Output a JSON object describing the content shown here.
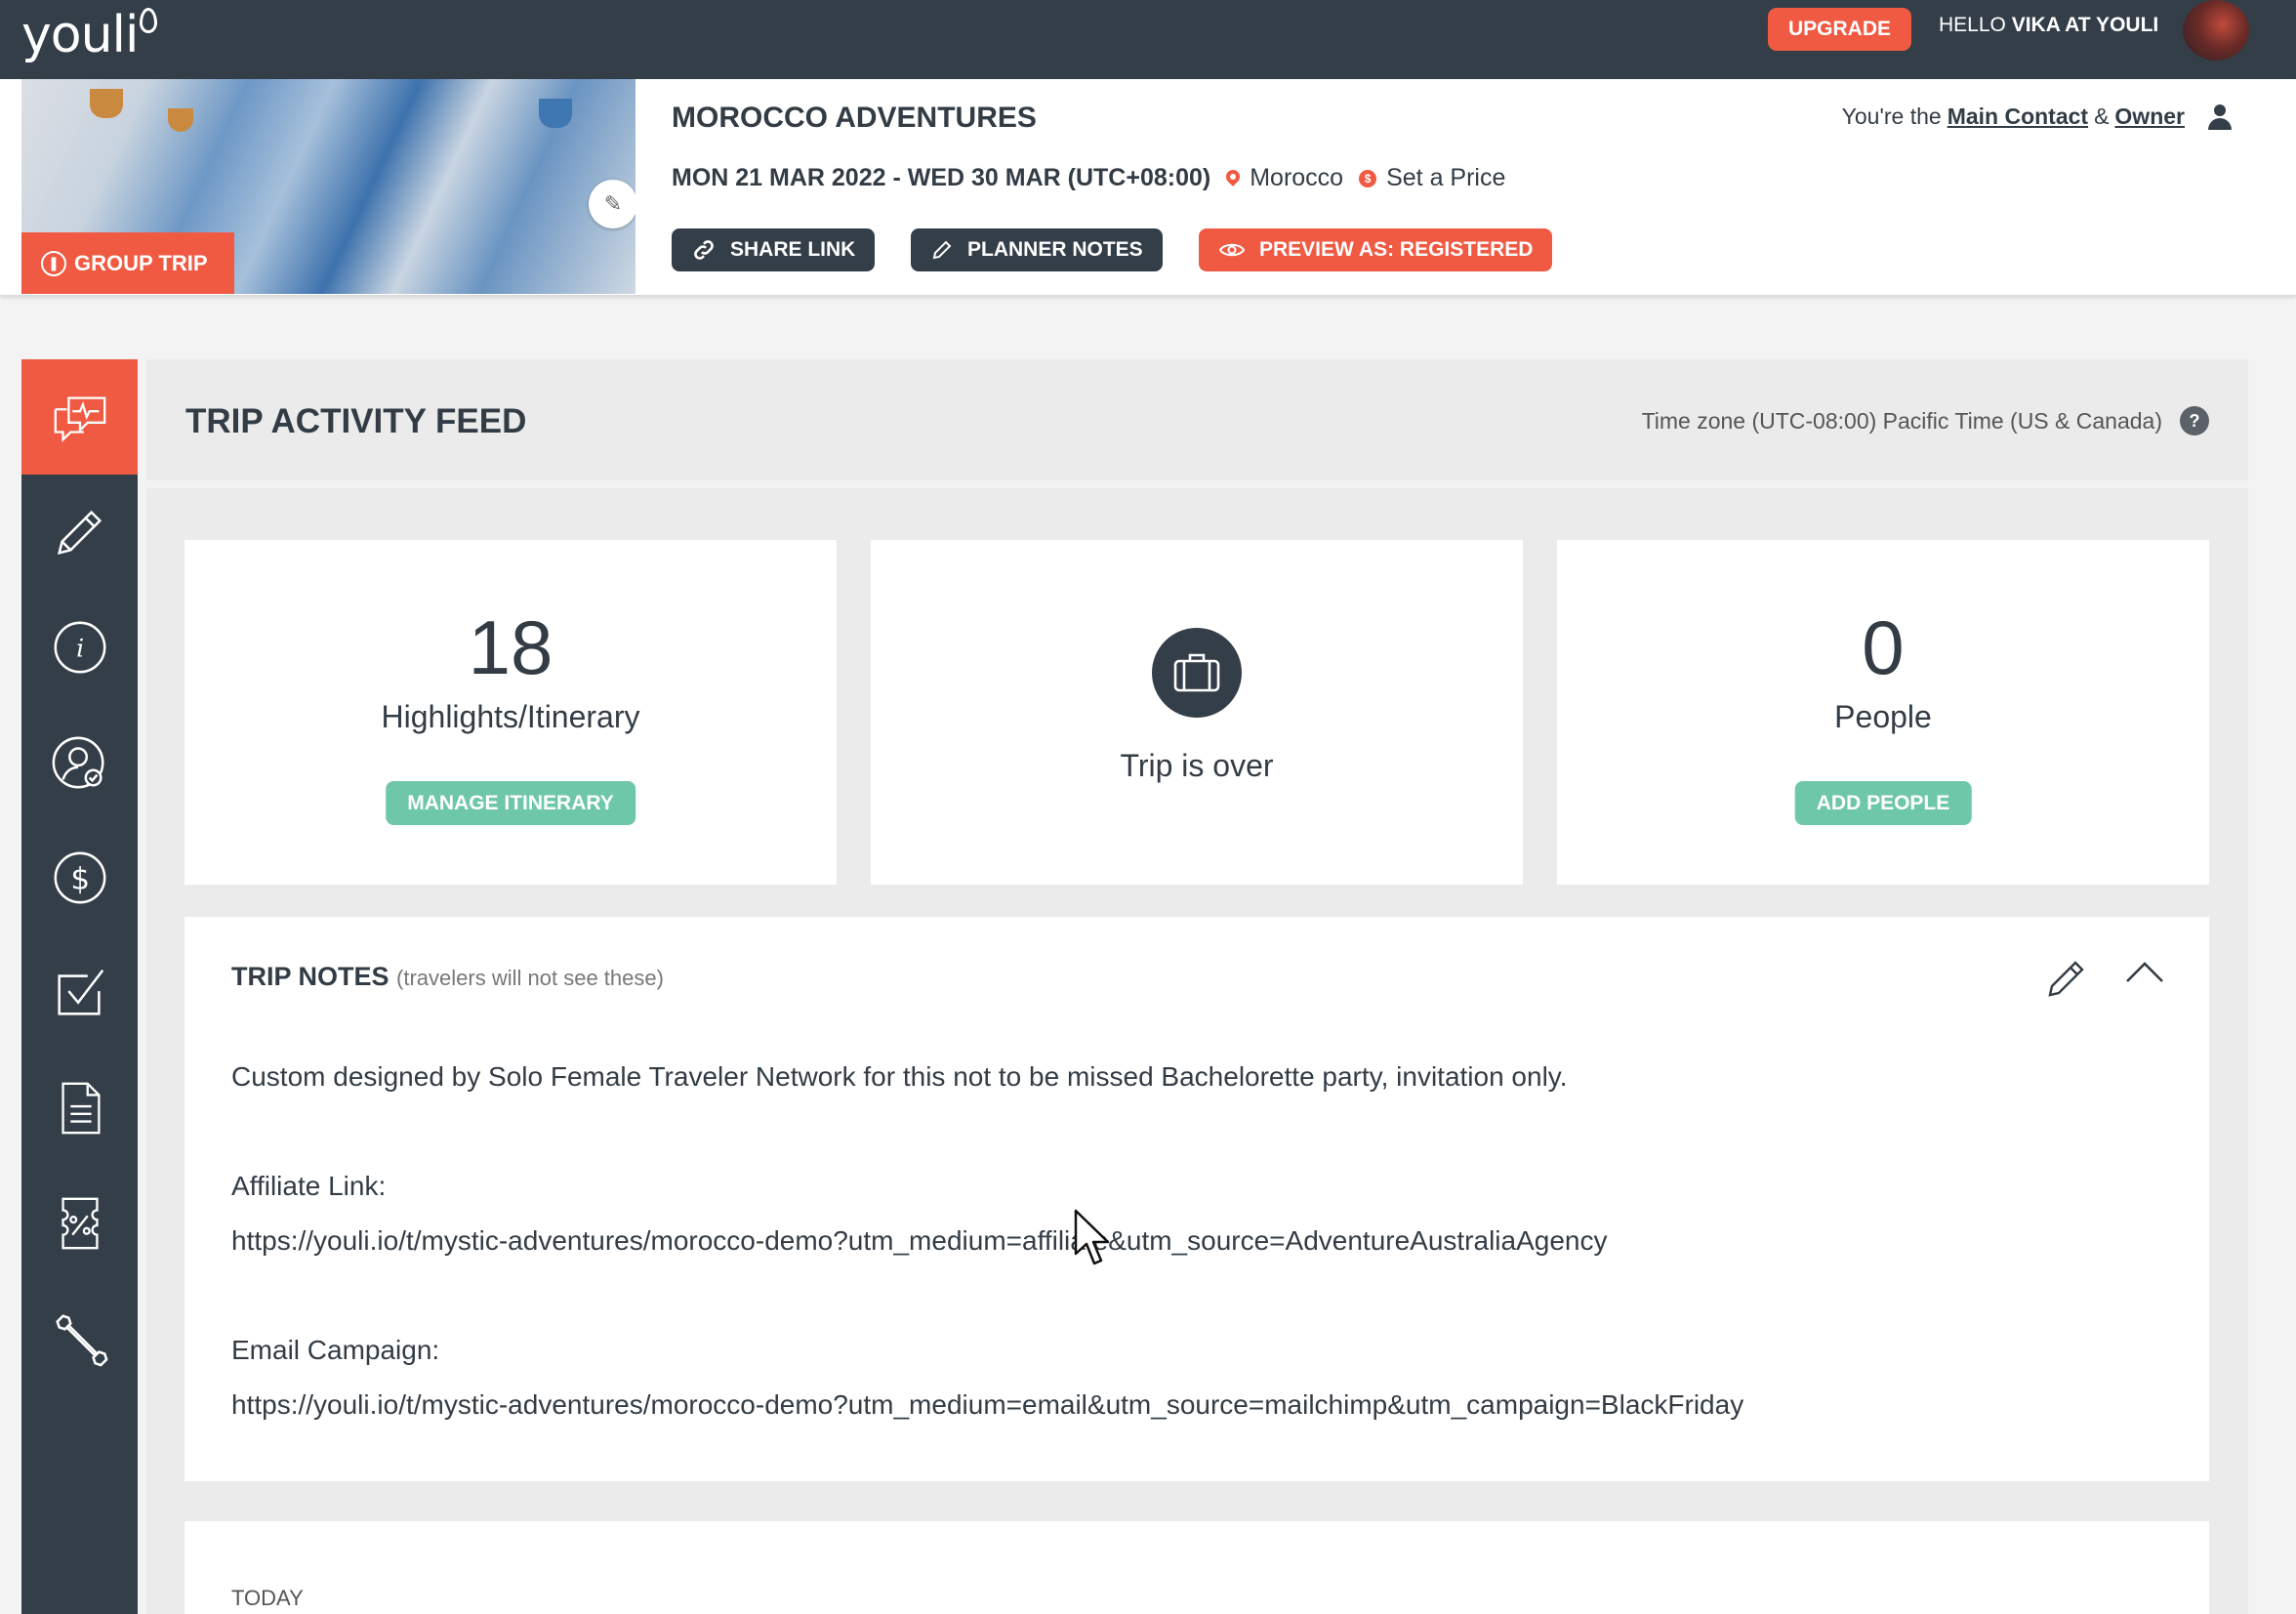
{
  "app": {
    "logo": "youli",
    "upgrade_label": "UPGRADE",
    "hello_prefix": "HELLO",
    "hello_user": "VIKA AT YOULI",
    "brand_color": "#f05a43",
    "dark_color": "#333e48",
    "green_color": "#6ec7a9"
  },
  "trip": {
    "badge": "GROUP TRIP",
    "title": "MOROCCO ADVENTURES",
    "dates": "MON 21 MAR 2022 - WED 30 MAR (UTC+08:00)",
    "location": "Morocco",
    "price_label": "Set a Price",
    "buttons": {
      "share": "SHARE LINK",
      "planner": "PLANNER NOTES",
      "preview": "PREVIEW AS: REGISTERED"
    },
    "contact": {
      "prefix": "You're the",
      "main_contact": "Main Contact",
      "amp": "&",
      "owner": "Owner"
    }
  },
  "sidebar": {
    "items": [
      {
        "icon": "activity-feed-icon",
        "active": true
      },
      {
        "icon": "pencil-icon"
      },
      {
        "icon": "info-icon"
      },
      {
        "icon": "people-check-icon"
      },
      {
        "icon": "dollar-icon"
      },
      {
        "icon": "checkbox-icon"
      },
      {
        "icon": "document-icon"
      },
      {
        "icon": "discount-ticket-icon"
      },
      {
        "icon": "wrench-icon"
      }
    ]
  },
  "feed": {
    "title": "TRIP ACTIVITY FEED",
    "timezone": "Time zone (UTC-08:00) Pacific Time (US & Canada)",
    "help": "?"
  },
  "cards": {
    "itinerary": {
      "count": "18",
      "label": "Highlights/Itinerary",
      "button": "MANAGE ITINERARY"
    },
    "status": {
      "label": "Trip is over",
      "icon": "suitcase-icon"
    },
    "people": {
      "count": "0",
      "label": "People",
      "button": "ADD PEOPLE"
    }
  },
  "notes": {
    "title": "TRIP NOTES",
    "subtitle": "(travelers will not see these)",
    "line1": "Custom designed by Solo Female Traveler Network for this not to be missed Bachelorette party, invitation only.",
    "affiliate_label": "Affiliate Link:",
    "affiliate_url": "https://youli.io/t/mystic-adventures/morocco-demo?utm_medium=affiliate&utm_source=AdventureAustraliaAgency",
    "email_label": "Email Campaign:",
    "email_url": "https://youli.io/t/mystic-adventures/morocco-demo?utm_medium=email&utm_source=mailchimp&utm_campaign=BlackFriday"
  },
  "timeline": {
    "today": "TODAY"
  }
}
